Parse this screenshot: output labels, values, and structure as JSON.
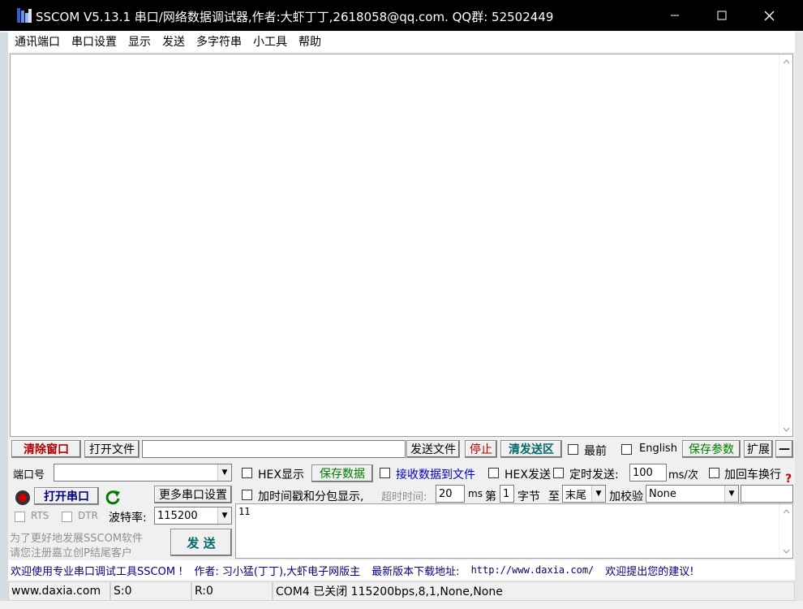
{
  "window": {
    "title": "SSCOM V5.13.1 串口/网络数据调试器,作者:大虾丁丁,2618058@qq.com. QQ群:  52502449",
    "app_icon": "sscom-app-icon"
  },
  "menu": [
    "通讯端口",
    "串口设置",
    "显示",
    "发送",
    "多字符串",
    "小工具",
    "帮助"
  ],
  "toolbar": {
    "clear_window": "清除窗口",
    "open_file": "打开文件",
    "file_path": "",
    "send_file": "发送文件",
    "stop": "停止",
    "clear_send": "清发送区",
    "front_label": "最前",
    "english_label": "English",
    "save_params": "保存参数",
    "expand": "扩展",
    "collapse": "—"
  },
  "port": {
    "port_label": "端口号",
    "port_value": "",
    "open_port": "打开串口",
    "more_settings": "更多串口设置",
    "rts_label": "RTS",
    "dtr_label": "DTR",
    "baud_label": "波特率:",
    "baud_value": "115200",
    "promo_line1": "为了更好地发展SSCOM软件",
    "promo_line2": "请您注册嘉立创P结尾客户",
    "send_button": "发  送"
  },
  "options": {
    "hex_display": "HEX显示",
    "save_data": "保存数据",
    "recv_to_file": "接收数据到文件",
    "hex_send": "HEX发送",
    "timed_send": "定时发送:",
    "interval_value": "100",
    "interval_unit": "ms/次",
    "add_crlf": "加回车换行",
    "timestamp": "加时间戳和分包显示,",
    "timeout_label": "超时时间:",
    "timeout_value": "20",
    "timeout_unit": "ms",
    "byte_from_label": "第",
    "byte_from_value": "1",
    "byte_unit": "字节",
    "byte_to_label": "至",
    "byte_to_value": "末尾",
    "checksum_label": "加校验",
    "checksum_value": "None"
  },
  "send_text": "11",
  "ad_bar": {
    "welcome": "欢迎使用专业串口调试工具SSCOM !",
    "author": "作者: 习小猛(丁丁),大虾电子网版主",
    "download_label": "最新版本下载地址:",
    "download_url": "http://www.daxia.com/",
    "feedback": "欢迎提出您的建议!"
  },
  "status": {
    "website": "www.daxia.com",
    "sent": "S:0",
    "received": "R:0",
    "port_status": "COM4 已关闭  115200bps,8,1,None,None"
  }
}
